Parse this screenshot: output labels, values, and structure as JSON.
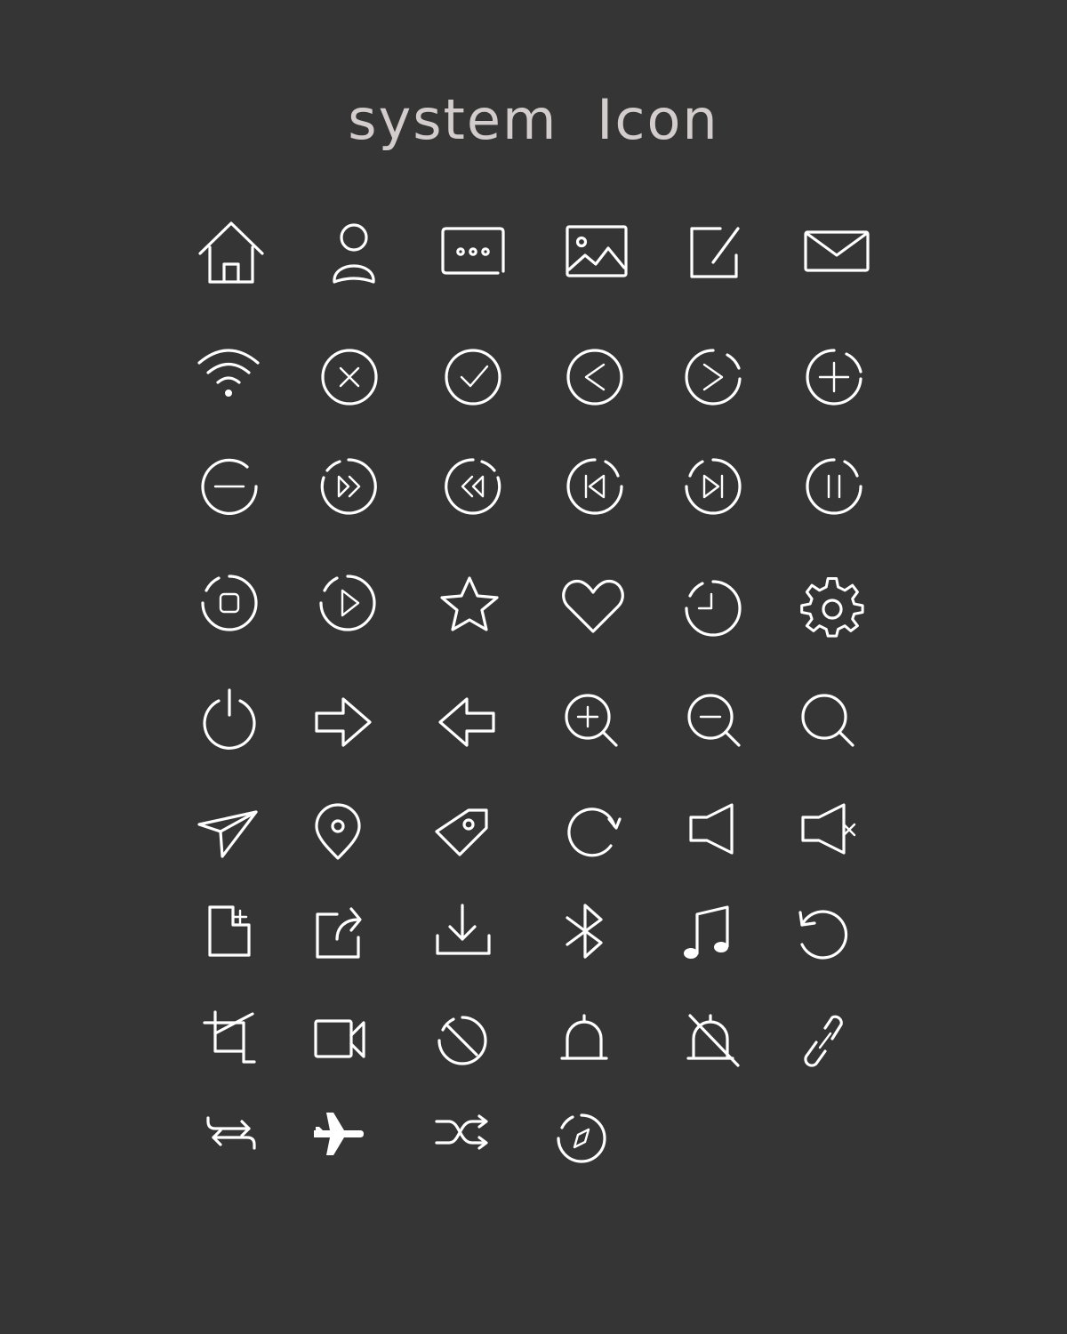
{
  "title": "system  Icon",
  "colors": {
    "background": "#353535",
    "title": "#d3cccc",
    "icon_stroke": "#ffffff"
  },
  "icons": [
    "home-icon",
    "user-icon",
    "message-more-icon",
    "image-icon",
    "edit-icon",
    "mail-icon",
    "wifi-icon",
    "close-circle-icon",
    "check-circle-icon",
    "chevron-left-circle-icon",
    "chevron-right-circle-icon",
    "plus-circle-icon",
    "minus-circle-icon",
    "fast-forward-circle-icon",
    "rewind-circle-icon",
    "skip-back-circle-icon",
    "skip-forward-circle-icon",
    "pause-circle-icon",
    "stop-circle-icon",
    "play-circle-icon",
    "star-icon",
    "heart-icon",
    "clock-icon",
    "gear-icon",
    "power-icon",
    "arrow-right-icon",
    "arrow-left-icon",
    "zoom-in-icon",
    "zoom-out-icon",
    "search-icon",
    "send-icon",
    "location-pin-icon",
    "tag-icon",
    "refresh-icon",
    "volume-icon",
    "volume-mute-icon",
    "new-file-icon",
    "share-icon",
    "download-icon",
    "bluetooth-icon",
    "music-note-icon",
    "undo-icon",
    "crop-icon",
    "video-camera-icon",
    "block-icon",
    "bell-icon",
    "bell-off-icon",
    "link-icon",
    "repeat-icon",
    "airplane-icon",
    "shuffle-icon",
    "compass-icon"
  ]
}
